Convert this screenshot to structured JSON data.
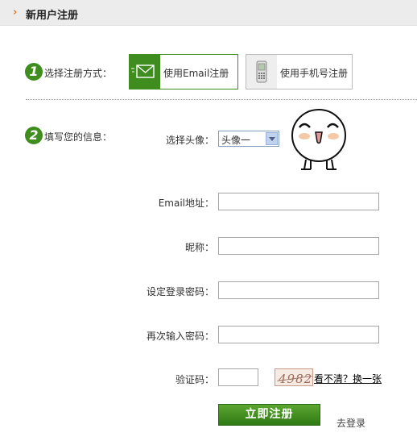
{
  "header": {
    "arrow": "›",
    "title": "新用户注册"
  },
  "step1": {
    "num": "1",
    "label": "选择注册方式："
  },
  "methods": [
    {
      "label": "使用Email注册",
      "icon": "envelope-icon",
      "active": true
    },
    {
      "label": "使用手机号注册",
      "icon": "mobile-phone-icon",
      "active": false
    }
  ],
  "step2": {
    "num": "2",
    "label": "填写您的信息："
  },
  "avatar": {
    "label": "选择头像：",
    "selected": "头像一"
  },
  "fields": {
    "email": {
      "label": "Email地址：",
      "value": ""
    },
    "nickname": {
      "label": "昵称：",
      "value": ""
    },
    "password": {
      "label": "设定登录密码：",
      "value": ""
    },
    "confirm": {
      "label": "再次输入密码：",
      "value": ""
    }
  },
  "captcha": {
    "label": "验证码：",
    "value": "",
    "image_text": "4982",
    "change_link": "看不清？换一张"
  },
  "actions": {
    "submit": "立即注册",
    "login": "去登录"
  },
  "colors": {
    "accent_green": "#3f8d1e",
    "header_arrow": "#e8731c",
    "header_bg": "#ececec"
  }
}
